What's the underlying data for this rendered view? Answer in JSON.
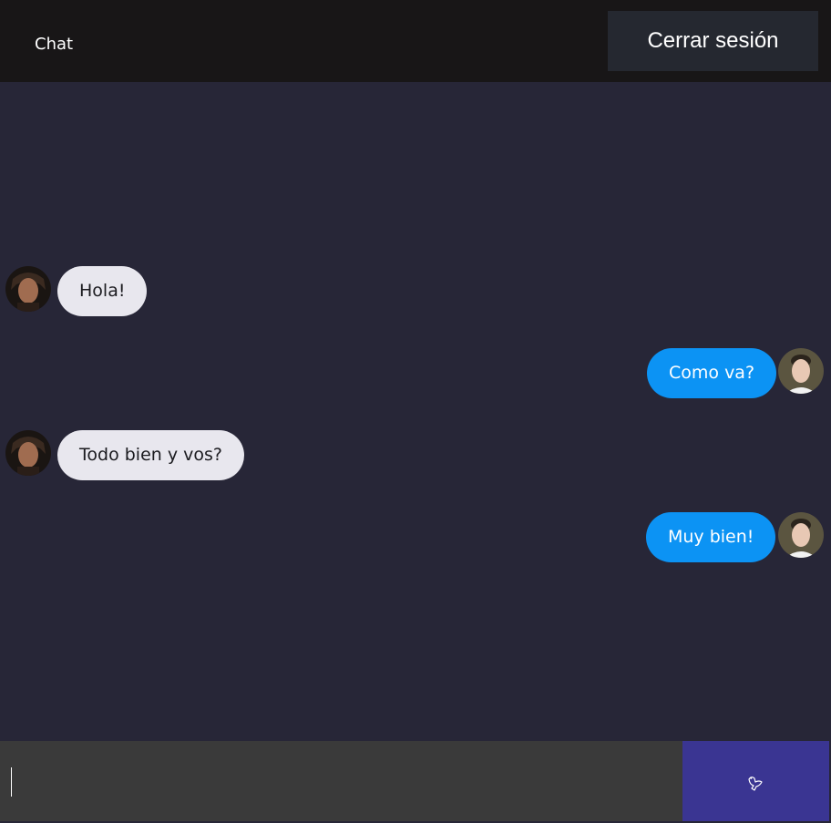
{
  "header": {
    "title": "Chat",
    "logout_label": "Cerrar sesión"
  },
  "messages": [
    {
      "direction": "incoming",
      "text": "Hola!",
      "avatar": "avatar-icon"
    },
    {
      "direction": "outgoing",
      "text": "Como va?",
      "avatar": "avatar-icon"
    },
    {
      "direction": "incoming",
      "text": "Todo bien y vos?",
      "avatar": "avatar-icon"
    },
    {
      "direction": "outgoing",
      "text": "Muy bien!",
      "avatar": "avatar-icon"
    }
  ],
  "composer": {
    "input_value": "",
    "send_icon": "dove-icon"
  },
  "colors": {
    "background": "#272637",
    "header": "#181617",
    "incoming_bubble": "#e8e7ee",
    "outgoing_bubble": "#0c93f4",
    "send_button": "#3a3592",
    "input": "#3a3a3a"
  }
}
